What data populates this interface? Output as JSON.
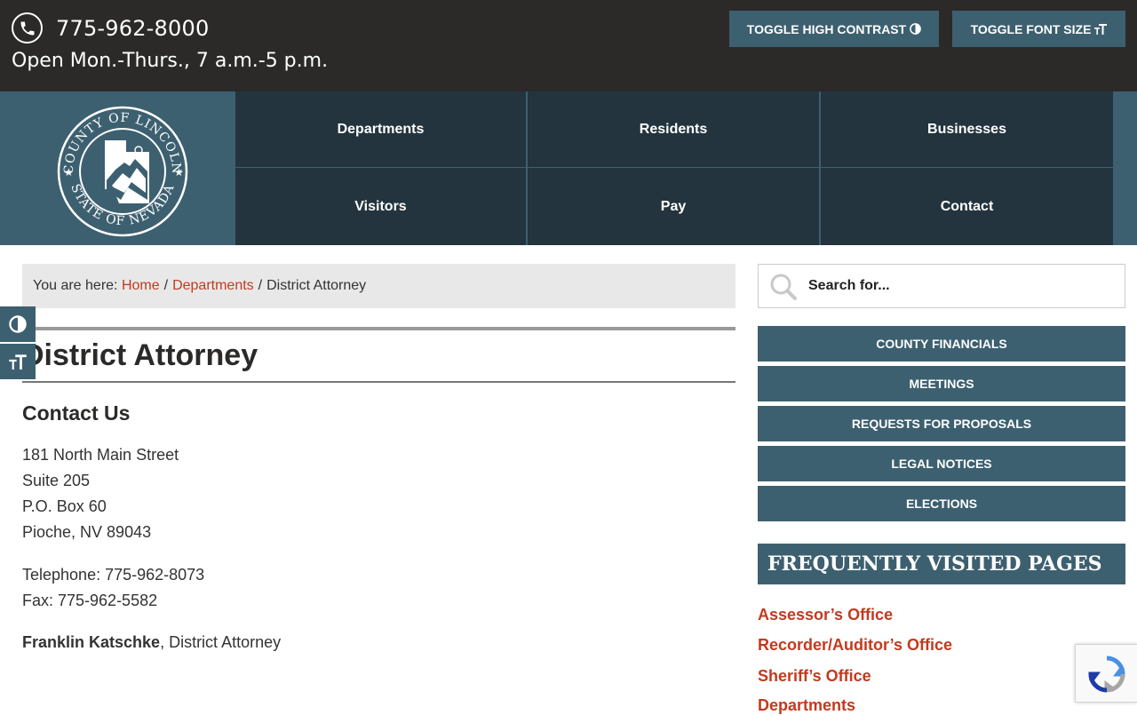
{
  "topbar": {
    "phone": "775-962-8000",
    "hours": "Open Mon.-Thurs., 7 a.m.-5 p.m.",
    "toggle_contrast_label": "TOGGLE HIGH CONTRAST",
    "toggle_font_label": "TOGGLE FONT SIZE"
  },
  "logo": {
    "top_text": "COUNTY OF LINCOLN",
    "bottom_text": "STATE OF NEVADA"
  },
  "nav": {
    "items": [
      {
        "label": "Departments"
      },
      {
        "label": "Residents"
      },
      {
        "label": "Businesses"
      },
      {
        "label": "Visitors"
      },
      {
        "label": "Pay"
      },
      {
        "label": "Contact"
      }
    ]
  },
  "breadcrumb": {
    "prefix": "You are here:",
    "home": "Home",
    "departments": "Departments",
    "current": "District Attorney",
    "separator": "/"
  },
  "main": {
    "title": "District Attorney",
    "contact_heading": "Contact Us",
    "address_lines": [
      "181 North Main Street",
      "Suite 205",
      "P.O. Box 60",
      "Pioche, NV 89043"
    ],
    "telephone": "Telephone: 775-962-8073",
    "fax": "Fax: 775-962-5582",
    "person_name": "Franklin Katschke",
    "person_role": ", District Attorney"
  },
  "sidebar": {
    "search_placeholder": "Search for...",
    "buttons": [
      "COUNTY FINANCIALS",
      "MEETINGS",
      "REQUESTS FOR PROPOSALS",
      "LEGAL NOTICES",
      "ELECTIONS"
    ],
    "fvp_heading": "FREQUENTLY VISITED PAGES",
    "fvp_links": [
      "Assessor’s Office",
      "Recorder/Auditor’s Office",
      "Sheriff’s Office",
      "Departments"
    ]
  },
  "colors": {
    "topbar_bg": "#2b2a29",
    "accent": "#3d6070",
    "nav_bg": "#23343e",
    "link": "#c23a1e"
  }
}
